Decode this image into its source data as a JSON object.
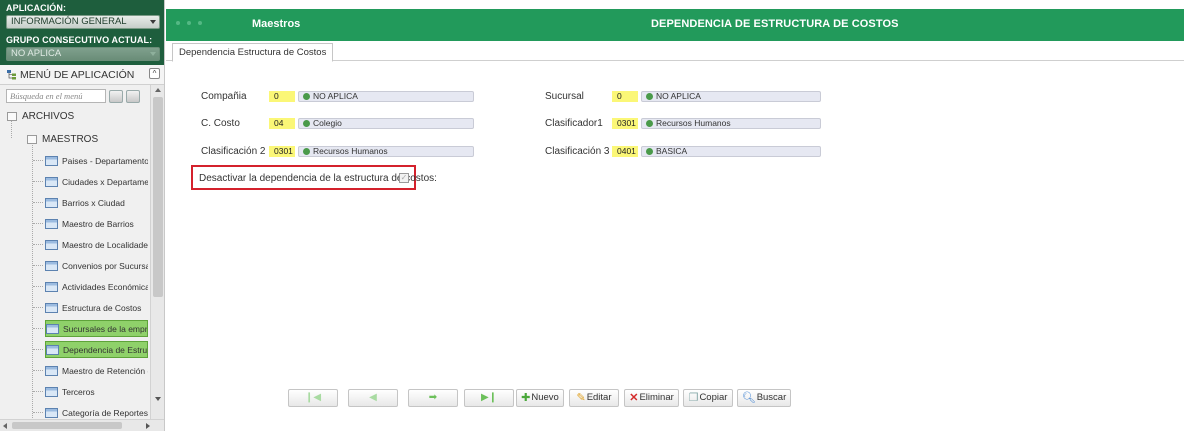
{
  "sidebar": {
    "app_label": "APLICACIÓN:",
    "app_value": "INFORMACIÓN GENERAL",
    "group_label": "GRUPO CONSECUTIVO ACTUAL:",
    "group_value": "NO APLICA",
    "menu_title": "MENÚ DE APLICACIÓN",
    "search_placeholder": "Búsqueda en el menú",
    "tree": {
      "archivos": "ARCHIVOS",
      "maestros": "MAESTROS",
      "items": [
        "Paises - Departamentos",
        "Ciudades x Departamento",
        "Barrios x Ciudad",
        "Maestro de Barrios",
        "Maestro de Localidades",
        "Convenios por Sucursal",
        "Actividades Económicas",
        "Estructura de Costos",
        "Sucursales de la empresa",
        "Dependencia de Estructur",
        "Maestro de Retención en",
        "Terceros",
        "Categoría de Reportes"
      ]
    }
  },
  "header": {
    "section": "Maestros",
    "title": "DEPENDENCIA DE ESTRUCTURA DE COSTOS"
  },
  "tab": {
    "label": "Dependencia Estructura de Costos"
  },
  "form": {
    "compania": {
      "label": "Compañia",
      "code": "0",
      "desc": "NO APLICA"
    },
    "sucursal": {
      "label": "Sucursal",
      "code": "0",
      "desc": "NO APLICA"
    },
    "costo": {
      "label": "C. Costo",
      "code": "04",
      "desc": "Colegio"
    },
    "clasificador1": {
      "label": "Clasificador1",
      "code": "0301",
      "desc": "Recursos Humanos"
    },
    "clasificacion2": {
      "label": "Clasificación 2",
      "code": "0301",
      "desc": "Recursos Humanos"
    },
    "clasificacion3": {
      "label": "Clasificación 3",
      "code": "0401",
      "desc": "BASICA"
    },
    "desactivar": {
      "label": "Desactivar la dependencia de la estructura de costos:",
      "checked": true
    }
  },
  "toolbar": {
    "nuevo": "Nuevo",
    "editar": "Editar",
    "eliminar": "Eliminar",
    "copiar": "Copiar",
    "buscar": "Buscar"
  },
  "colors": {
    "header_green": "#229a5b",
    "sidebar_dark_green": "#1e5e3d",
    "selected_item": "#8fd16a",
    "code_field": "#fbf777",
    "highlight_border": "#d4212c"
  }
}
